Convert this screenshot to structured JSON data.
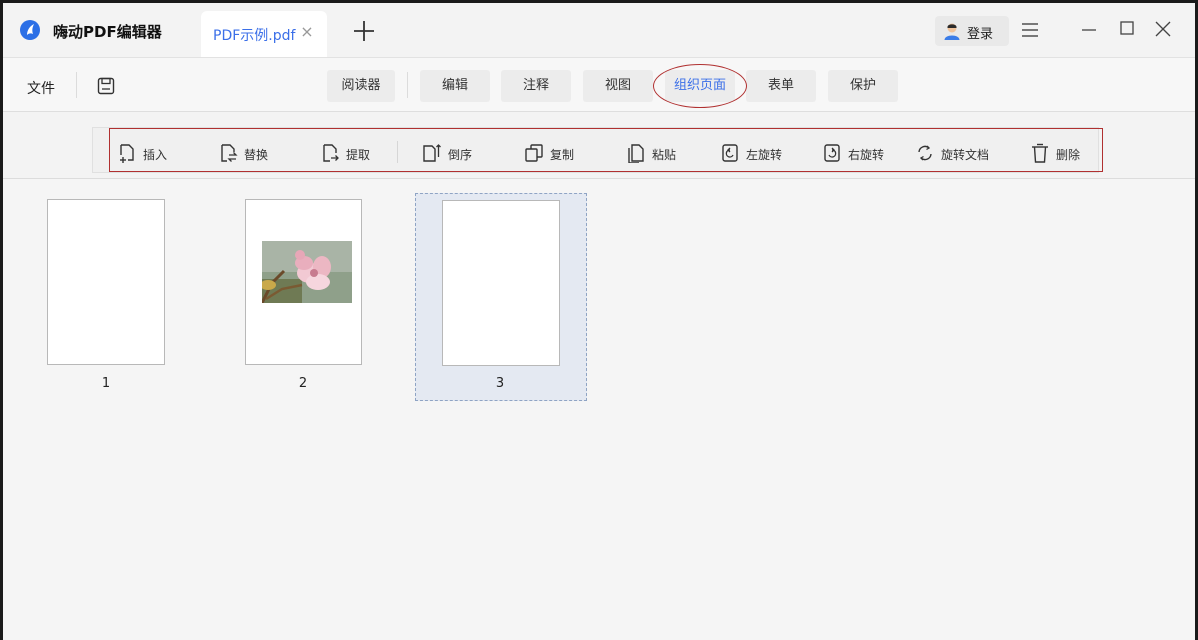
{
  "app": {
    "title": "嗨动PDF编辑器",
    "accent": "#3b6fe8",
    "highlight_color": "#b03030"
  },
  "tabs": [
    {
      "label": "PDF示例.pdf",
      "close": "×"
    }
  ],
  "header": {
    "login_label": "登录",
    "icons": [
      "app-logo-icon",
      "close-icon",
      "plus-icon",
      "user-icon",
      "hamburger-menu-icon",
      "minimize-icon",
      "maximize-icon",
      "close-window-icon"
    ]
  },
  "menubar": {
    "file_label": "文件",
    "save_icon": "save-icon",
    "tabs": [
      {
        "label": "阅读器",
        "active": false
      },
      {
        "label": "编辑",
        "active": false
      },
      {
        "label": "注释",
        "active": false
      },
      {
        "label": "视图",
        "active": false
      },
      {
        "label": "组织页面",
        "active": true
      },
      {
        "label": "表单",
        "active": false
      },
      {
        "label": "保护",
        "active": false
      }
    ]
  },
  "toolbar": {
    "items": [
      {
        "label": "插入",
        "icon": "insert-page-icon"
      },
      {
        "label": "替换",
        "icon": "replace-page-icon"
      },
      {
        "label": "提取",
        "icon": "extract-page-icon"
      },
      {
        "label": "倒序",
        "icon": "reverse-order-icon"
      },
      {
        "label": "复制",
        "icon": "copy-icon"
      },
      {
        "label": "粘贴",
        "icon": "paste-icon"
      },
      {
        "label": "左旋转",
        "icon": "rotate-left-icon"
      },
      {
        "label": "右旋转",
        "icon": "rotate-right-icon"
      },
      {
        "label": "旋转文档",
        "icon": "rotate-document-icon"
      },
      {
        "label": "删除",
        "icon": "trash-icon"
      }
    ]
  },
  "pages": [
    {
      "number": "1",
      "has_image": false,
      "selected": false
    },
    {
      "number": "2",
      "has_image": true,
      "selected": false
    },
    {
      "number": "3",
      "has_image": false,
      "selected": true
    }
  ]
}
